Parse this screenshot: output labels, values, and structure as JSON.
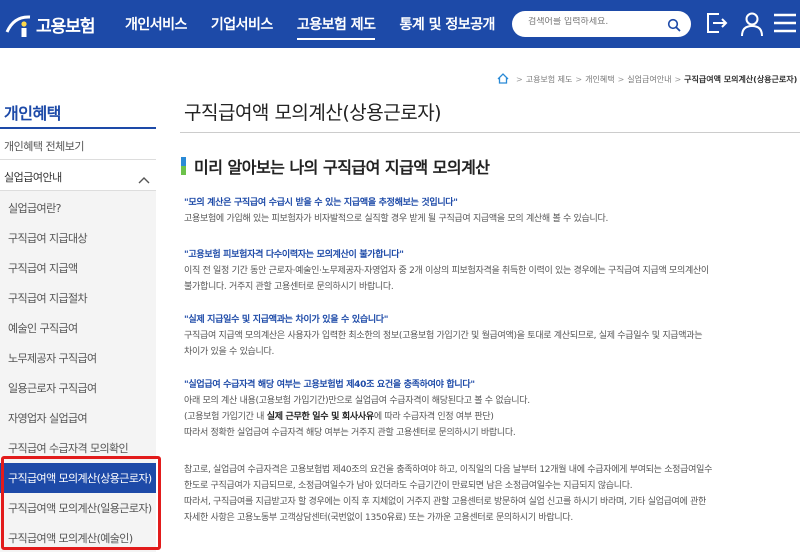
{
  "header": {
    "logo_text": "고용보험",
    "nav": [
      "개인서비스",
      "기업서비스",
      "고용보험 제도",
      "통계 및 정보공개"
    ],
    "search_placeholder": "검색어를 입력하세요.",
    "brand_color": "#1d4aa8"
  },
  "sidebar": {
    "title": "개인혜택",
    "all_link": "개인혜택 전체보기",
    "group": "실업급여안내",
    "items": [
      "실업급여란?",
      "구직급여 지급대상",
      "구직급여 지급액",
      "구직급여 지급절차",
      "예술인 구직급여",
      "노무제공자 구직급여",
      "일용근로자 구직급여",
      "자영업자 실업급여",
      "구직급여 수급자격 모의확인",
      "구직급여액 모의계산(상용근로자)",
      "구직급여액 모의계산(일용근로자)",
      "구직급여액 모의계산(예술인)"
    ],
    "active_index": 9
  },
  "breadcrumb": [
    "고용보험 제도",
    "개인혜택",
    "실업급여안내",
    "구직급여액 모의계산(상용근로자)"
  ],
  "page_title": "구직급여액 모의계산(상용근로자)",
  "section_title": "미리 알아보는 나의 구직급여 지급액 모의계산",
  "notes": [
    {
      "q": "\"모의 계산은 구직급여 수급시 받을 수 있는 지급액을 추정해보는 것입니다\"",
      "lines": [
        "고용보험에 가입해 있는 피보험자가 비자발적으로 실직할 경우 받게 될 구직급여 지급액을 모의 계산해 볼 수 있습니다."
      ]
    },
    {
      "q": "\"고용보험 피보험자격 다수이력자는 모의계산이 불가합니다\"",
      "lines": [
        "이직 전 일정 기간 동안 근로자·예술인·노무제공자·자영업자 중 2개 이상의 피보험자격을 취득한 이력이 있는 경우에는 구직급여 지급액 모의계산이",
        "불가합니다. 거주지 관할 고용센터로 문의하시기 바랍니다."
      ]
    },
    {
      "q": "\"실제 지급일수 및 지급액과는 차이가 있을 수 있습니다\"",
      "lines": [
        "구직급여 지급액 모의계산은 사용자가 입력한 최소한의 정보(고용보험 가입기간 및 월급여액)을 토대로 계산되므로, 실제 수급일수 및 지급액과는",
        "차이가 있을 수 있습니다."
      ]
    },
    {
      "q": "\"실업급여 수급자격 해당 여부는 고용보험법 제40조 요건을 충족하여야 합니다\"",
      "lines": [
        "아래 모의 계산 내용(고용보험 가입기간)만으로 실업급여 수급자격이 해당된다고 볼 수 없습니다."
      ],
      "line2_pre": "(고용보험 가입기간 내 ",
      "line2_bold": "실제 근무한 일수 및 회사사유",
      "line2_post": "에 따라 수급자격 인정 여부 판단)",
      "line3": "따라서 정확한 실업급여 수급자격 해당 여부는 거주지 관할 고용센터로 문의하시기 바랍니다."
    }
  ],
  "reference": [
    "참고로, 실업급여 수급자격은 고용보험법 제40조의 요건을 충족하여야 하고, 이직일의 다음 날부터 12개월 내에 수급자에게 부여되는 소정급여일수",
    "한도로 구직급여가 지급되므로, 소정급여일수가 남아 있더라도 수급기간이 만료되면 남은 소정급여일수는 지급되지 않습니다.",
    "따라서, 구직급여를 지급받고자 할 경우에는 이직 후 지체없이 거주지 관할 고용센터로 방문하여 실업 신고를 하시기 바라며, 기타 실업급여에 관한",
    "자세한 사항은 고용노동부 고객상담센터(국번없이 1350유료) 또는 가까운 고용센터로 문의하시기 바랍니다."
  ]
}
